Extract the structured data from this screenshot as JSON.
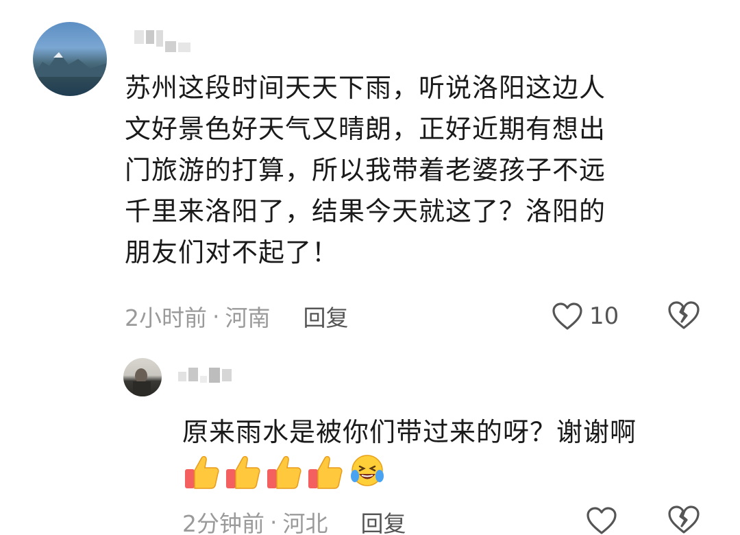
{
  "comment": {
    "text": "苏州这段时间天天下雨，听说洛阳这边人\n文好景色好天气又晴朗，正好近期有想出\n门旅游的打算，所以我带着老婆孩子不远\n千里来洛阳了，结果今天就这了？洛阳的\n朋友们对不起了！",
    "time": "2小时前",
    "separator": "·",
    "location": "河南",
    "reply_label": "回复",
    "like_count": "10",
    "username_blurred": true
  },
  "reply": {
    "text": "原来雨水是被你们带过来的呀？谢谢啊",
    "emojis": [
      "thumbs-up-emoji",
      "thumbs-up-emoji",
      "thumbs-up-emoji",
      "thumbs-up-emoji",
      "laughing-emoji"
    ],
    "time": "2分钟前",
    "separator": "·",
    "location": "河北",
    "reply_label": "回复",
    "username_blurred": true
  },
  "icons": {
    "like": "heart-outline-icon",
    "dislike": "broken-heart-icon"
  },
  "colors": {
    "text": "#1a1a1a",
    "meta": "#9a9a9a",
    "icon": "#555555",
    "background": "#ffffff"
  }
}
